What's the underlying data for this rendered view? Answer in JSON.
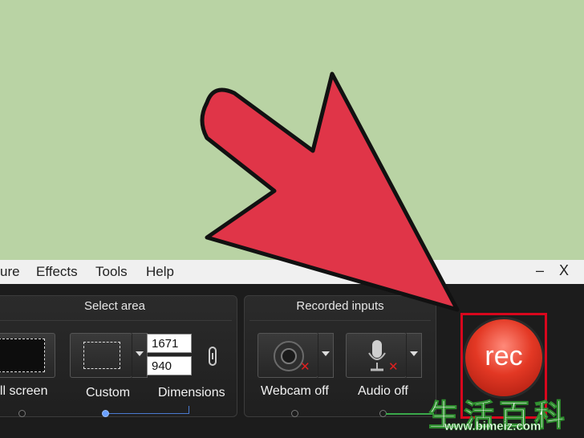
{
  "menu": {
    "items": [
      "ure",
      "Effects",
      "Tools",
      "Help"
    ],
    "minimize": "–",
    "close": "X"
  },
  "select_area": {
    "title": "Select area",
    "full_screen_label": "ull screen",
    "custom_label": "Custom",
    "dimensions_label": "Dimensions",
    "width": "1671",
    "height": "940"
  },
  "recorded_inputs": {
    "title": "Recorded inputs",
    "webcam_label": "Webcam off",
    "audio_label": "Audio off"
  },
  "rec_button": {
    "label": "rec"
  },
  "watermark": {
    "chars": "生活百科",
    "url": "www.bimeiz.com"
  },
  "colors": {
    "background": "#b9d3a4",
    "arrow": "#e03548",
    "highlight": "#d8071d",
    "rec": "#e33824"
  }
}
